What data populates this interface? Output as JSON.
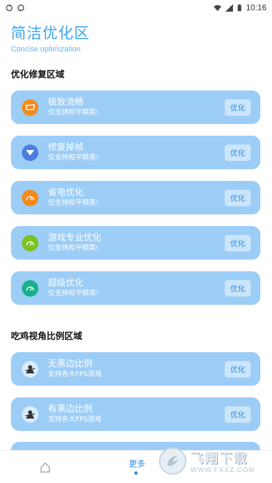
{
  "status_bar": {
    "time": "10:16",
    "left_icons": [
      "sync-icon",
      "sync-icon"
    ],
    "right_icons": [
      "wifi-icon",
      "signal-icon",
      "battery-icon"
    ]
  },
  "header": {
    "title": "简洁优化区",
    "subtitle": "Concise optimization"
  },
  "sections": [
    {
      "title": "优化修复区域",
      "items": [
        {
          "title": "极致流畅",
          "subtitle": "仅支持和平精英!",
          "button": "优化",
          "icon": "speed-icon",
          "icon_color": "#f48a1a"
        },
        {
          "title": "修复掉帧",
          "subtitle": "仅支持和平精英!",
          "button": "优化",
          "icon": "repair-icon",
          "icon_color": "#4a7fe0"
        },
        {
          "title": "省电优化",
          "subtitle": "仅支持和平精英!",
          "button": "优化",
          "icon": "gauge-icon",
          "icon_color": "#f48a1a"
        },
        {
          "title": "游戏专业优化",
          "subtitle": "仅支持和平精英!",
          "button": "优化",
          "icon": "gauge-icon",
          "icon_color": "#7ac21e"
        },
        {
          "title": "超级优化",
          "subtitle": "仅支持和平精英!",
          "button": "优化",
          "icon": "gauge-icon",
          "icon_color": "#19b08a"
        }
      ]
    },
    {
      "title": "吃鸡视角比例区域",
      "items": [
        {
          "title": "无黑边比例",
          "subtitle": "支持各大FPS游戏",
          "button": "优化",
          "icon": "character-icon",
          "icon_color": "#3a6ea8"
        },
        {
          "title": "有黑边比例",
          "subtitle": "支持各大FPS游戏",
          "button": "优化",
          "icon": "character-icon",
          "icon_color": "#3a6ea8"
        }
      ]
    }
  ],
  "bottom_nav": {
    "home_icon": "home-icon",
    "more_label": "更多"
  },
  "watermark": {
    "main": "飞翔下载",
    "url": "WWW.FXXZ.COM"
  },
  "colors": {
    "accent": "#3fa6ee",
    "card_bg": "#9ccdf7",
    "button_bg": "#cbe5fb",
    "button_text": "#2f8fe0"
  }
}
